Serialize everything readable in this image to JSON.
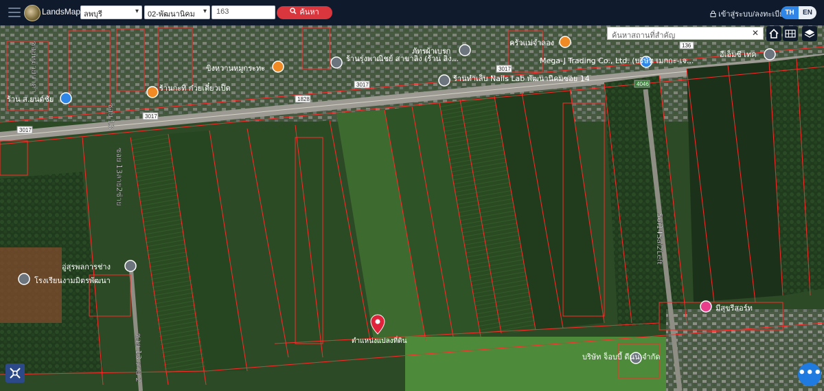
{
  "header": {
    "brand": "LandsMaps",
    "province": "ลพบุรี",
    "district": "02-พัฒนานิคม",
    "parcel_number": "163",
    "search_label": "ค้นหา",
    "login_label": "เข้าสู่ระบบ/ลงทะเบียน",
    "lang_th": "TH",
    "lang_en": "EN"
  },
  "map_tools": {
    "place_search_placeholder": "ค้นหาสถานที่สำคัญ"
  },
  "map": {
    "parcel_marker_label": "ตำแหน่งแปลงที่ดิน",
    "road_labels": [
      "3017",
      "3017",
      "3017",
      "1828",
      "3017",
      "136",
      "4046"
    ],
    "street_labels": [
      "ซอย 13",
      "ซอย 13ลาย2ซ้าย",
      "ซอย 13 ลาย 2",
      "Soi14Sai2Left",
      "ซอยหมายนาคา"
    ],
    "pois": [
      {
        "name": "ร้าน ส.ยนต์ชัย",
        "icon": "store-icon"
      },
      {
        "name": "ร้านกะทิ ก๋วยเตี๋ยวเป็ด",
        "icon": "restaurant-icon"
      },
      {
        "name": "ขิงหวานหมูกระทะ",
        "icon": "restaurant-icon"
      },
      {
        "name": "ร้านรุ่งพาณิชย์ สาขาลิ่ง (ร้าน ลิ่ง...",
        "icon": "place-icon"
      },
      {
        "name": "ภัทรผ้าเบรก",
        "icon": "place-icon"
      },
      {
        "name": "ร้านทำเล็บ Nails Lab พัฒนานิคมซอย 14",
        "icon": "place-icon"
      },
      {
        "name": "ครัวแม่จำลอง",
        "icon": "restaurant-icon"
      },
      {
        "name": "Mega-J Trading Co., Ltd. (บริษัท เมกกะ-เจ...",
        "icon": "lock-icon"
      },
      {
        "name": "อีเอ็มซี เทค",
        "icon": "place-icon"
      },
      {
        "name": "อู่สุรพลการช่าง",
        "icon": "place-icon"
      },
      {
        "name": "โรงเรียนงามมิตรพัฒนา",
        "icon": "school-icon"
      },
      {
        "name": "มีสุขรีสอร์ท",
        "icon": "hotel-icon"
      },
      {
        "name": "บริษัท จ็อบบี้ ดีนน จำกัด",
        "icon": "place-icon"
      }
    ]
  },
  "colors": {
    "topbar": "#0f1b2d",
    "search_button": "#d9363e",
    "parcel_lines": "#ff2b2b",
    "marker": "#e0223a",
    "lang_active": "#2f86e6",
    "fab": "#1f7be0"
  }
}
